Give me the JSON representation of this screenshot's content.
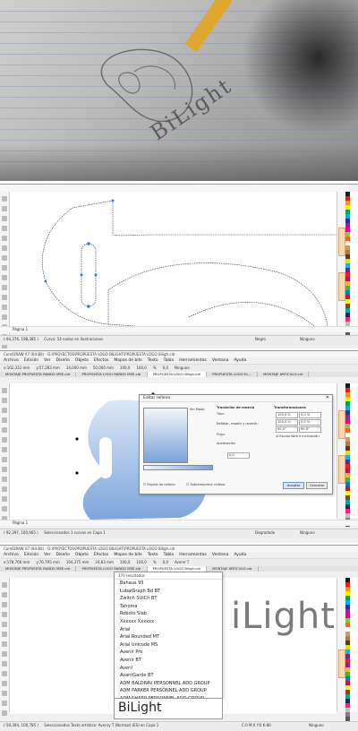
{
  "photo": {
    "sketch_text": "BiLight"
  },
  "colors": {
    "accent_blue": "#7aa3d8",
    "palette": [
      "#1a1a1a",
      "#e31b23",
      "#f7941d",
      "#fff200",
      "#00a651",
      "#00aeef",
      "#2e3192",
      "#92278f",
      "#ec008c",
      "#8dc63f",
      "#f26522",
      "#ffffff",
      "#c69c6d",
      "#a67c52",
      "#603913",
      "#d7df23",
      "#29abe2",
      "#662d91",
      "#ed1c24",
      "#9e1f63",
      "#fbb040",
      "#39b54a",
      "#1b75bc",
      "#be1e2d",
      "#f9ed32",
      "#754c24",
      "#00a99d",
      "#262262",
      "#ee2a7b",
      "#bcbec0",
      "#808285",
      "#58595b"
    ]
  },
  "screen1": {
    "title": "CorelDRAW X7 (64-Bit) - D:\\PROYECTOS\\PROPUESTA LOGO BILIGHT\\PROPUESTA LOGO Biligh.cdr",
    "page_tab": "Página 1",
    "status_text": "Curva: 54 nodos en Ilustraciones",
    "coords": "(-94,376, 198,385 )",
    "fill_status": "Ninguno",
    "outline_status": "Negro"
  },
  "screen2": {
    "title": "CorelDRAW X7 (64-Bit) - D:\\PROYECTOS\\PROPUESTA LOGO BILIGHT\\PROPUESTA LOGO Biligh.cdr",
    "menu": [
      "Archivo",
      "Edición",
      "Ver",
      "Diseño",
      "Objeto",
      "Efectos",
      "Mapas de bits",
      "Texto",
      "Tabla",
      "Herramientas",
      "Ventana",
      "Ayuda"
    ],
    "toolbar_values": [
      "x:102,331 mm",
      "y:57,283 mm",
      "34,000 mm",
      "50,000 mm",
      "100,0",
      "100,0",
      "%",
      "0,0",
      "Ninguno"
    ],
    "tabs": [
      "MONTAJE PROPUESTA RANDO MSE.cdr",
      "PROPUESTA LOGO RANDO MSE.cdr",
      "PROPUESTA LOGO Biligh.cdr",
      "PROPUESTA LOGO EL...",
      "MONTAJE ARTICULO.cdr"
    ],
    "dialog": {
      "title": "Editar relleno",
      "mode": "Sin Modo",
      "section_transition": "Transición de mezcla",
      "section_transform": "Transformaciones",
      "type_label": "Tipo:",
      "repeat_label": "Reflejar, repetir y revertir:",
      "smoothing_label": "Flujo:",
      "accelerate": "Aceleración",
      "w_value": "100,0 %",
      "h_value": "100,0 %",
      "x_value": "0,0 %",
      "y_value": "0,0 %",
      "rotate_value": "90,0°",
      "skew_value": "90,0°",
      "angle_value": "0,0",
      "checkbox_free_scale": "Escala libre e inclinación",
      "checkbox_fill_behind": "Espiral de relleno",
      "checkbox_overprint": "Sobreimprimir relleno",
      "ok": "Aceptar",
      "cancel": "Cancelar"
    },
    "page_tab": "Página 1",
    "status_text": "Seleccionados 3 curvas en Capa 1",
    "coords": "( 92,397, 100,965 )",
    "fill_status": "Degradado",
    "outline_status": "Ninguno"
  },
  "screen3": {
    "title": "CorelDRAW X7 (64-Bit) - D:\\PROYECTOS\\PROPUESTA LOGO BILIGHT\\PROPUESTA LOGO Biligh.cdr",
    "menu": [
      "Archivo",
      "Edición",
      "Ver",
      "Diseño",
      "Objeto",
      "Efectos",
      "Mapas de bits",
      "Texto",
      "Tabla",
      "Herramientas",
      "Ventana",
      "Ayuda"
    ],
    "toolbar_values": [
      "x:178,766 mm",
      "y:76,795 mm",
      "104,375 mm",
      "24,83 mm",
      "100,0",
      "100,0",
      "%",
      "0,0",
      "Avenir T"
    ],
    "tabs": [
      "MONTAJE PROPUESTA RANDO MSE.cdr",
      "PROPUESTA LOGO RANDO MSE.cdr",
      "PROPUESTA LOGO Biligh.cdr",
      "MONTAJE ARTICULO.cdr"
    ],
    "font_count": "170 resultados",
    "fonts": [
      "Bahaus 93",
      "LubalGraph Bd BT",
      "Zwitch SUICh BT",
      "Tahoma",
      "Roboto Slab",
      "Xxxxxx Xxxxxx",
      "Arial",
      "Arial Rounded MT",
      "Arial Unicode MS",
      "Avenir Pro",
      "Avenir BT",
      "Averil",
      "AvantGarde BT",
      "ADM BALDRAV PERSONNEL ADD GROUP",
      "ADM PARKER PERSONNEL ADD GROUP",
      "ADM SHARP PERSONNEL ADD GROUP",
      "Avenry"
    ],
    "selected_font": "Avenry",
    "preview_text": "BiLight",
    "canvas_text": "iLight",
    "status_text": "Seleccionados Texto artístico: Avenry T (Normal) (ES) en Capa 1",
    "coords": "(-59,394, 100,785 )",
    "fill_status": "C:0 M:0 Y:0 K:80",
    "outline_status": "Ninguno"
  }
}
